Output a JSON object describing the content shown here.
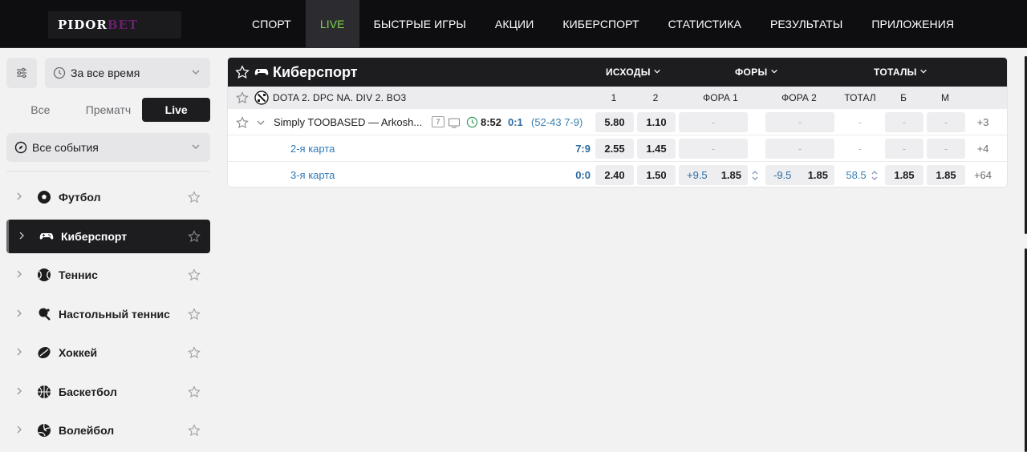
{
  "header": {
    "logo_part1": "PIDOR",
    "logo_part2": "BET",
    "nav": [
      "СПОРТ",
      "LIVE",
      "БЫСТРЫЕ ИГРЫ",
      "АКЦИИ",
      "КИБЕРСПОРТ",
      "СТАТИСТИКА",
      "РЕЗУЛЬТАТЫ",
      "ПРИЛОЖЕНИЯ"
    ],
    "active_nav": "LIVE",
    "active_color": "#7fd34a"
  },
  "sidebar": {
    "time_filter": "За все время",
    "segments": [
      "Все",
      "Прематч",
      "Live"
    ],
    "active_segment": "Live",
    "events_filter": "Все события",
    "sports": [
      {
        "name": "Футбол",
        "icon": "soccer-ball-icon"
      },
      {
        "name": "Киберспорт",
        "icon": "gamepad-icon",
        "active": true
      },
      {
        "name": "Теннис",
        "icon": "tennis-ball-icon"
      },
      {
        "name": "Настольный теннис",
        "icon": "table-tennis-icon"
      },
      {
        "name": "Хоккей",
        "icon": "hockey-puck-icon"
      },
      {
        "name": "Баскетбол",
        "icon": "basketball-icon"
      },
      {
        "name": "Волейбол",
        "icon": "volleyball-icon"
      }
    ]
  },
  "panel": {
    "title": "Киберспорт",
    "columns": {
      "outcomes": "ИСХОДЫ",
      "handicaps": "ФОРЫ",
      "totals": "ТОТАЛЫ"
    },
    "league": "DOTA 2. DPC NA. DIV 2. BO3",
    "sub_headers": {
      "h1": "1",
      "h2": "2",
      "fora1": "ФОРА 1",
      "fora2": "ФОРА 2",
      "total": "ТОТАЛ",
      "b": "Б",
      "m": "М"
    },
    "match": {
      "teams": "Simply TOOBASED — Arkosh...",
      "badge": "7",
      "time": "8:52",
      "score": "0:1",
      "details": "(52-43 7-9)",
      "odd1": "5.80",
      "odd2": "1.10",
      "dash": "-",
      "more": "+3"
    },
    "maps": [
      {
        "name": "2-я карта",
        "score": "7:9",
        "odd1": "2.55",
        "odd2": "1.45",
        "more": "+4"
      },
      {
        "name": "3-я карта",
        "score": "0:0",
        "odd1": "2.40",
        "odd2": "1.50",
        "fora1_h": "+9.5",
        "fora1_o": "1.85",
        "fora2_h": "-9.5",
        "fora2_o": "1.85",
        "total": "58.5",
        "b": "1.85",
        "m": "1.85",
        "more": "+64"
      }
    ]
  }
}
